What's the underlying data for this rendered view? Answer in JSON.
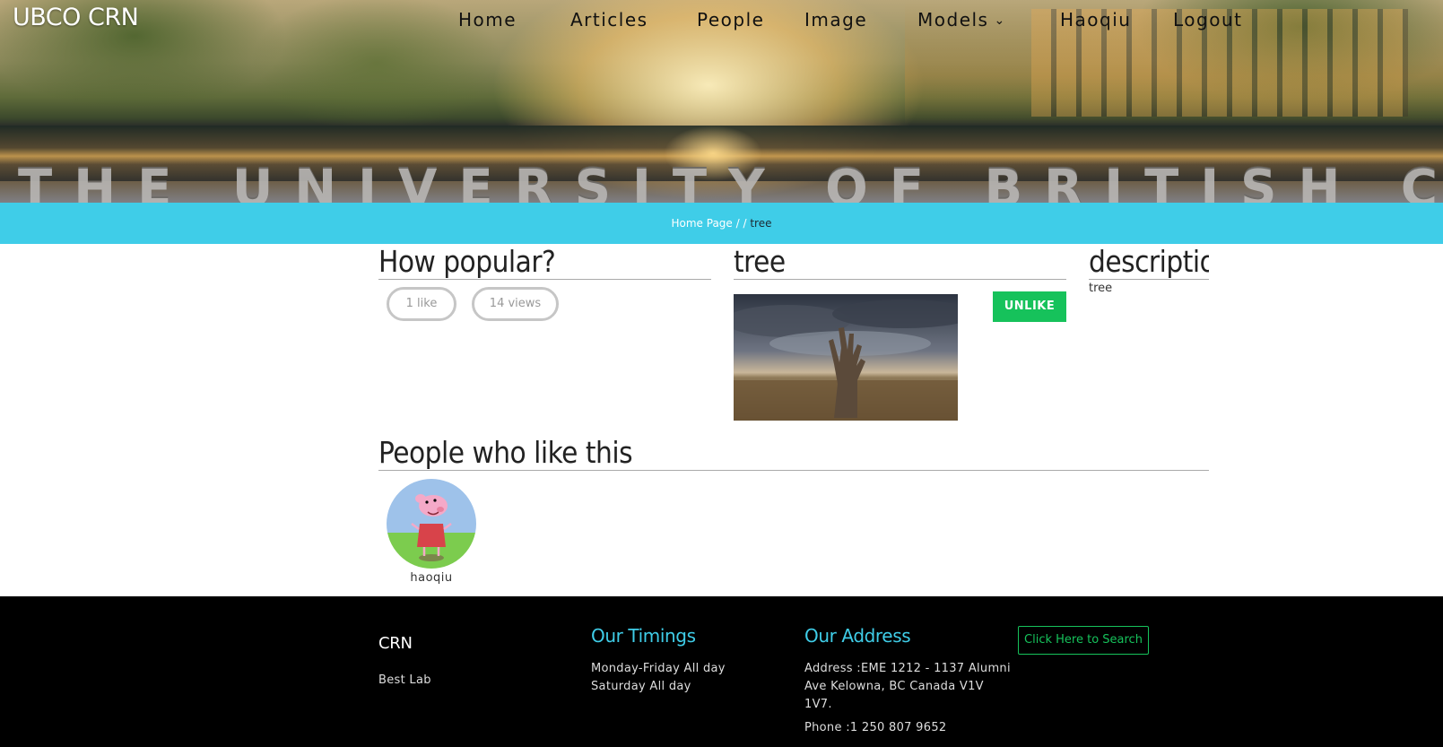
{
  "header": {
    "brand": "UBCO CRN",
    "nav": [
      {
        "label": "Home"
      },
      {
        "label": "Articles"
      },
      {
        "label": "People"
      },
      {
        "label": "Image"
      },
      {
        "label": "Models"
      },
      {
        "label": "Haoqiu"
      },
      {
        "label": "Logout"
      }
    ],
    "hero_wall_text": "THE UNIVERSITY OF BRITISH COLU"
  },
  "breadcrumb": {
    "home": "Home Page",
    "separator": " / / ",
    "current": "tree"
  },
  "popularity": {
    "title": "How popular?",
    "likes": "1 like",
    "views": "14 views"
  },
  "item": {
    "title": "tree",
    "unlike_label": "UNLIKE"
  },
  "description": {
    "title": "description",
    "text": "tree"
  },
  "likers": {
    "title": "People who like this",
    "people": [
      {
        "name": "haoqiu"
      }
    ]
  },
  "footer": {
    "brand": "CRN",
    "tagline": "Best Lab",
    "timings_title": "Our Timings",
    "timings_line1": "Monday-Friday All day",
    "timings_line2": "Saturday All day",
    "address_title": "Our Address",
    "address_line1": "Address :EME 1212 - 1137 Alumni",
    "address_line2": "Ave Kelowna, BC Canada V1V",
    "address_line3": "1V7.",
    "phone": "Phone :1 250 807 9652",
    "search_button": "Click Here to Search"
  },
  "colors": {
    "accent_cyan": "#3fcde8",
    "accent_green": "#16c25b",
    "footer_bg": "#000000"
  }
}
